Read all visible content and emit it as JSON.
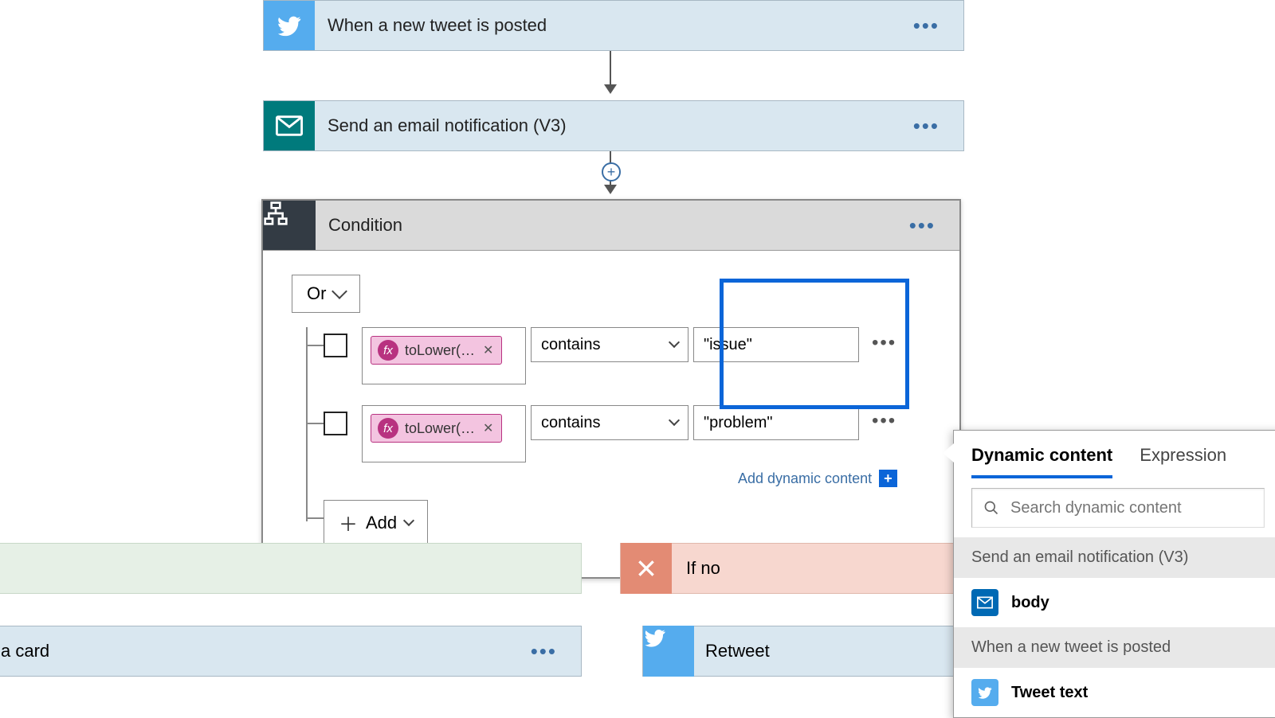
{
  "steps": {
    "trigger": {
      "title": "When a new tweet is posted"
    },
    "action1": {
      "title": "Send an email notification (V3)"
    }
  },
  "condition": {
    "title": "Condition",
    "group_operator": "Or",
    "rows": [
      {
        "left_pill": "toLower(…",
        "operator": "contains",
        "right_value": "\"issue\""
      },
      {
        "left_pill": "toLower(…",
        "operator": "contains",
        "right_value": "\"problem\""
      }
    ],
    "add_label": "Add",
    "add_dynamic_label": "Add dynamic content"
  },
  "branches": {
    "no": {
      "label": "If no"
    },
    "yes_card": {
      "label": "a card"
    },
    "no_card": {
      "label": "Retweet"
    }
  },
  "popout": {
    "tabs": {
      "dynamic": "Dynamic content",
      "expression": "Expression"
    },
    "search_placeholder": "Search dynamic content",
    "groups": [
      {
        "header": "Send an email notification (V3)",
        "items": [
          {
            "label": "body",
            "icon": "mail"
          }
        ]
      },
      {
        "header": "When a new tweet is posted",
        "items": [
          {
            "label": "Tweet text",
            "icon": "twitter"
          }
        ]
      }
    ]
  }
}
